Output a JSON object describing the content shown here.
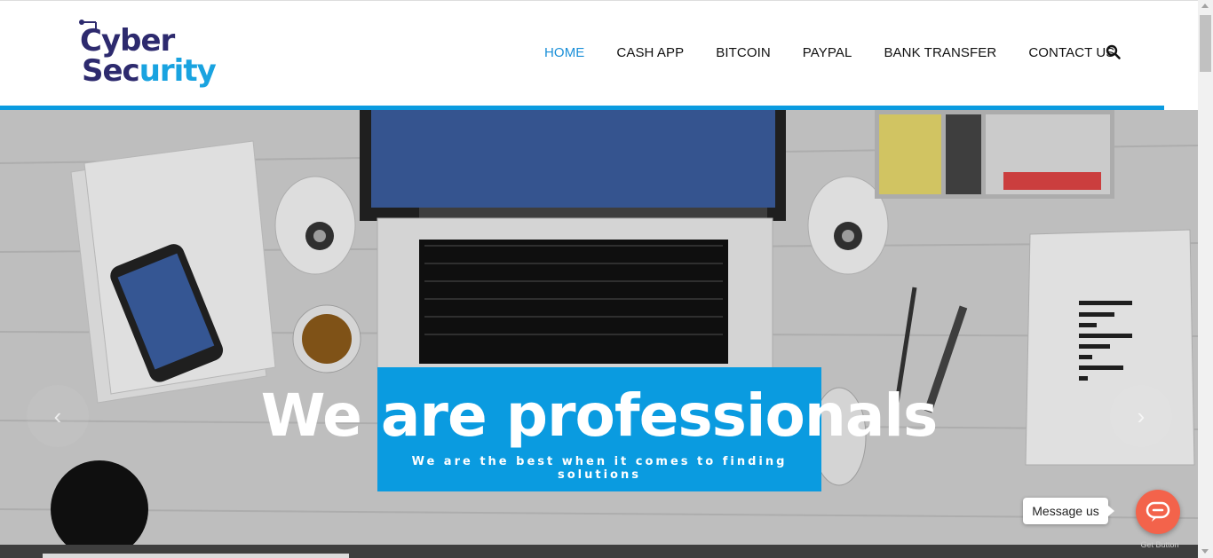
{
  "logo": {
    "line1": "Cyber",
    "line2_dark": "Sec",
    "line2_blue": "urity"
  },
  "nav": {
    "items": [
      {
        "label": "HOME",
        "active": true
      },
      {
        "label": "CASH APP",
        "active": false
      },
      {
        "label": "BITCOIN",
        "active": false
      },
      {
        "label": "PAYPAL",
        "active": false
      },
      {
        "label": "BANK TRANSFER",
        "active": false
      },
      {
        "label": "CONTACT US",
        "active": false
      }
    ],
    "search_icon": "search-icon"
  },
  "hero": {
    "title": "We are professionals",
    "subtitle": "We are the best when it comes to finding solutions",
    "prev_icon": "‹",
    "next_icon": "›"
  },
  "widget": {
    "message_label": "Message us",
    "footer_label": "Get Button",
    "icon": "chat-icon"
  },
  "colors": {
    "accent": "#0a9be0",
    "brand_dark": "#2d2a6e",
    "widget": "#f3634b"
  }
}
